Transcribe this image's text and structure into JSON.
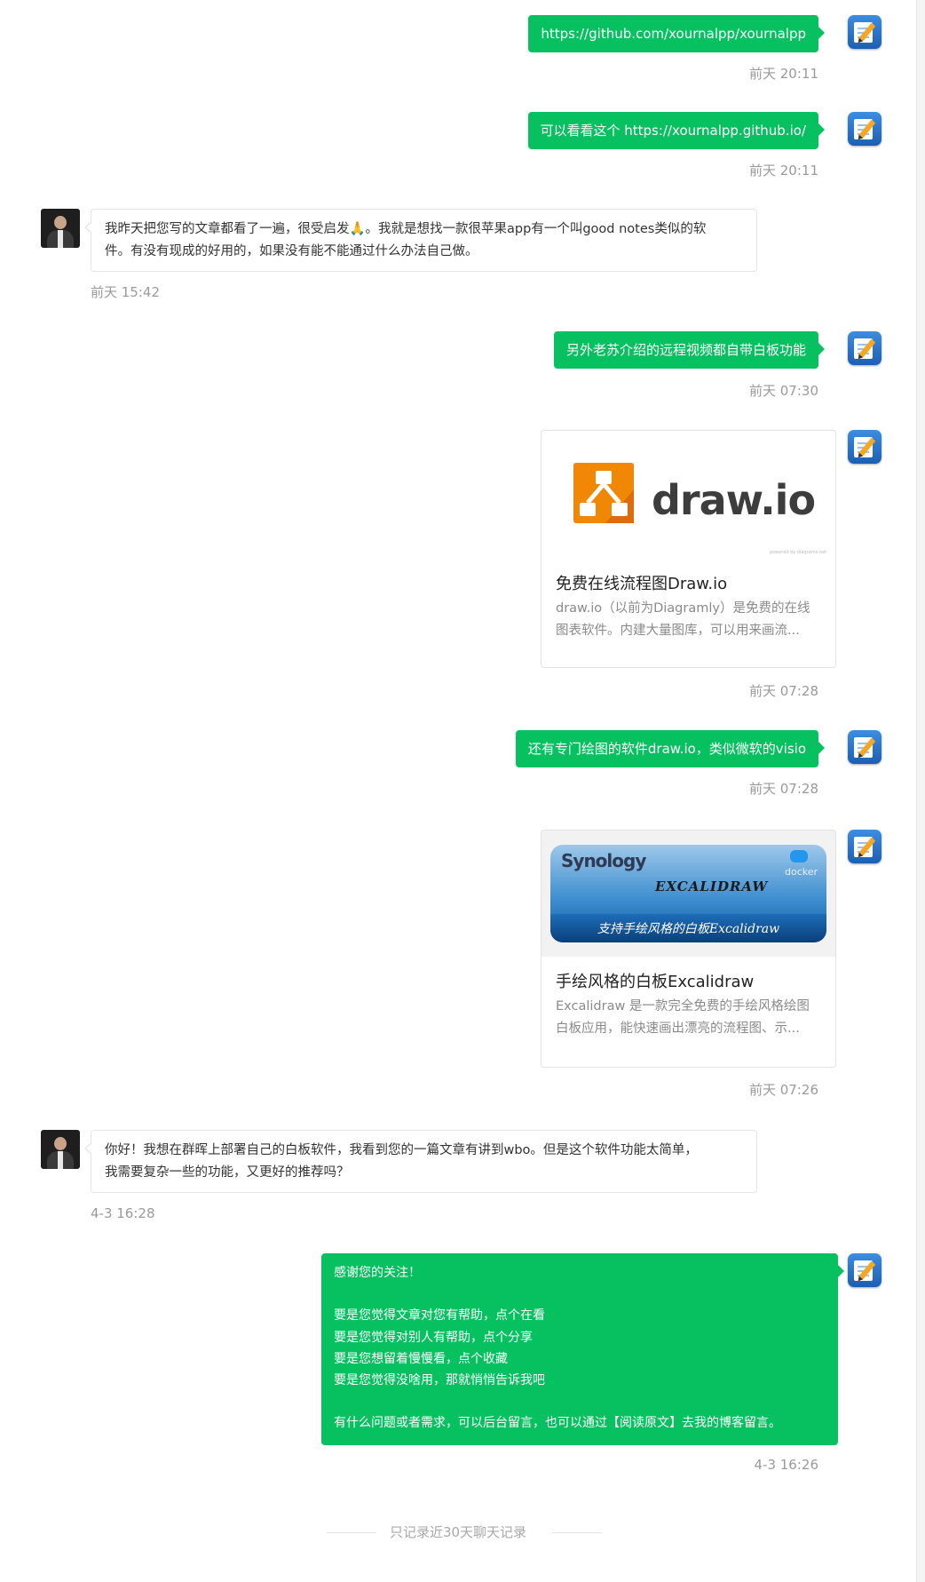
{
  "messages": {
    "m1": {
      "text": "https://github.com/xournalpp/xournalpp",
      "time": "前天 20:11"
    },
    "m2": {
      "text": "可以看看这个 https://xournalpp.github.io/",
      "time": "前天 20:11"
    },
    "m3": {
      "line1": "我昨天把您写的文章都看了一遍，很受启发🙏。我就是想找一款很苹果app有一个叫good notes类似的软",
      "line2": "件。有没有现成的好用的，如果没有能不能通过什么办法自己做。",
      "time": "前天 15:42"
    },
    "m4": {
      "text": "另外老苏介绍的远程视频都自带白板功能",
      "time": "前天 07:30"
    },
    "card1": {
      "logo_text": "draw.io",
      "small_caption": "powered by diagrams.net",
      "title": "免费在线流程图Draw.io",
      "desc1": "draw.io（以前为Diagramly）是免费的在线",
      "desc2": "图表软件。内建大量图库，可以用来画流...",
      "time": "前天 07:28"
    },
    "m5": {
      "text": "还有专门绘图的软件draw.io，类似微软的visio",
      "time": "前天 07:28"
    },
    "card2": {
      "banner_brand": "Synology",
      "banner_app": "EXCALIDRAW",
      "banner_docker": "docker",
      "banner_caption": "支持手绘风格的白板Excalidraw",
      "title": "手绘风格的白板Excalidraw",
      "desc1": "Excalidraw 是一款完全免费的手绘风格绘图",
      "desc2": "白板应用，能快速画出漂亮的流程图、示...",
      "time": "前天 07:26"
    },
    "m6": {
      "line1": "你好！我想在群晖上部署自己的白板软件，我看到您的一篇文章有讲到wbo。但是这个软件功能太简单，",
      "line2": "我需要复杂一些的功能，又更好的推荐吗？",
      "time": "4-3 16:28"
    },
    "m7": {
      "lines": [
        "感谢您的关注！",
        "",
        "要是您觉得文章对您有帮助，点个在看",
        "要是您觉得对别人有帮助，点个分享",
        "要是您想留着慢慢看，点个收藏",
        "要是您觉得没啥用，那就悄悄告诉我吧",
        "",
        "有什么问题或者需求，可以后台留言，也可以通过【阅读原文】去我的博客留言。"
      ],
      "time": "4-3 16:26"
    }
  },
  "footer": {
    "text": "只记录近30天聊天记录"
  },
  "colors": {
    "bubble_me": "#07c160",
    "drawio_orange": "#f08705",
    "drawio_text": "#3d3d3d"
  },
  "icons": {
    "my_avatar": "notepad-pencil-icon",
    "contact_avatar": "person-photo-icon"
  }
}
